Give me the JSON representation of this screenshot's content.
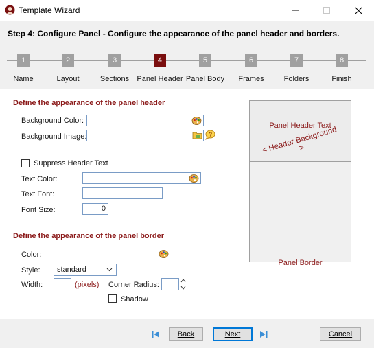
{
  "window": {
    "title": "Template Wizard"
  },
  "header": {
    "step": "Step 4: Configure Panel",
    "separator": " - ",
    "description": "Configure the appearance of the panel header and borders."
  },
  "steps": [
    {
      "num": "1",
      "label": "Name"
    },
    {
      "num": "2",
      "label": "Layout"
    },
    {
      "num": "3",
      "label": "Sections"
    },
    {
      "num": "4",
      "label": "Panel Header"
    },
    {
      "num": "5",
      "label": "Panel Body"
    },
    {
      "num": "6",
      "label": "Frames"
    },
    {
      "num": "7",
      "label": "Folders"
    },
    {
      "num": "8",
      "label": "Finish"
    }
  ],
  "active_step": 4,
  "panel_header": {
    "section_title": "Define the appearance of the panel header",
    "bg_color_label": "Background Color:",
    "bg_color_value": "",
    "bg_image_label": "Background Image:",
    "bg_image_value": "",
    "suppress_label": "Suppress Header Text",
    "suppress_checked": false,
    "text_color_label": "Text Color:",
    "text_color_value": "",
    "text_font_label": "Text Font:",
    "text_font_value": "",
    "font_size_label": "Font Size:",
    "font_size_value": "0"
  },
  "panel_border": {
    "section_title": "Define the appearance of the panel border",
    "color_label": "Color:",
    "color_value": "",
    "style_label": "Style:",
    "style_value": "standard",
    "width_label": "Width:",
    "width_value": "",
    "width_unit": "(pixels)",
    "radius_label": "Corner Radius:",
    "radius_value": "",
    "shadow_label": "Shadow",
    "shadow_checked": false
  },
  "preview": {
    "header_text": "Panel Header Text",
    "header_background": "< Header Background >",
    "border_text": "Panel Border"
  },
  "footer": {
    "back_label": "Back",
    "next_label": "Next",
    "cancel_label": "Cancel"
  },
  "colors": {
    "accent_dark_red": "#7a0e0e",
    "section_red": "#8b1a1a",
    "field_border": "#7a9cc6",
    "nav_blue": "#3c8fd6"
  },
  "icons": {
    "app": "wizard-app-icon",
    "color_picker": "palette-icon",
    "image_picker": "folder-image-icon",
    "help": "help-bubble-icon",
    "first": "first-page-icon",
    "last": "last-page-icon"
  }
}
